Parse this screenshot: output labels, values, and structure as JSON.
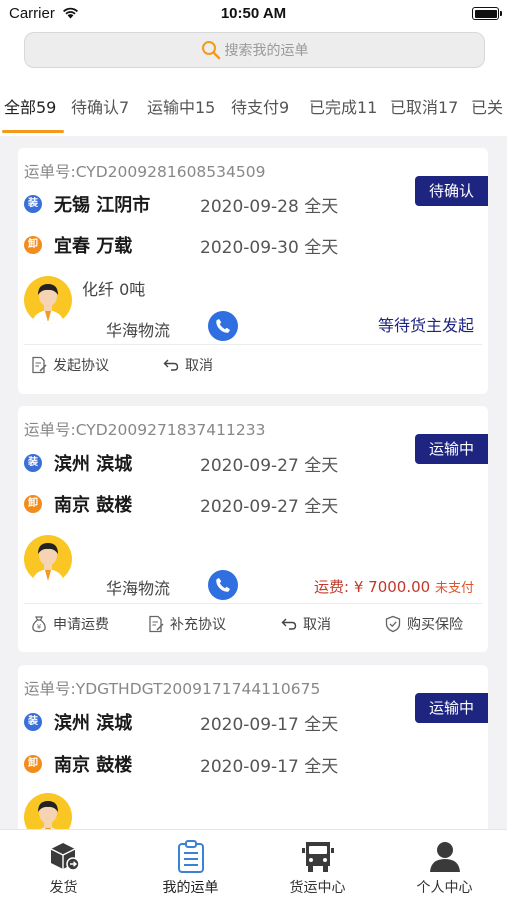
{
  "status_bar": {
    "carrier": "Carrier",
    "time": "10:50 AM"
  },
  "search": {
    "placeholder": "搜索我的运单"
  },
  "tabs": [
    {
      "label": "全部59",
      "active": true
    },
    {
      "label": "待确认7"
    },
    {
      "label": "运输中15"
    },
    {
      "label": "待支付9"
    },
    {
      "label": "已完成11"
    },
    {
      "label": "已取消17"
    },
    {
      "label": "已关"
    }
  ],
  "orders": [
    {
      "order_no": "运单号:CYD2009281608534509",
      "status": "待确认",
      "load_badge": "装",
      "unload_badge": "卸",
      "from": "无锡 江阴市",
      "from_date": "2020-09-28 全天",
      "to": "宜春 万载",
      "to_date": "2020-09-30 全天",
      "cargo": "化纤   0吨",
      "company": "华海物流",
      "note": "等待货主发起",
      "actions": [
        "发起协议",
        "取消"
      ]
    },
    {
      "order_no": "运单号:CYD2009271837411233",
      "status": "运输中",
      "load_badge": "装",
      "unload_badge": "卸",
      "from": "滨州 滨城",
      "from_date": "2020-09-27 全天",
      "to": "南京 鼓楼",
      "to_date": "2020-09-27 全天",
      "company": "华海物流",
      "fee": "运费: ¥ 7000.00",
      "fee_status": "未支付",
      "actions": [
        "申请运费",
        "补充协议",
        "取消",
        "购买保险"
      ]
    },
    {
      "order_no": "运单号:YDGTHDGT2009171744110675",
      "status": "运输中",
      "load_badge": "装",
      "unload_badge": "卸",
      "from": "滨州 滨城",
      "from_date": "2020-09-17 全天",
      "to": "南京 鼓楼",
      "to_date": "2020-09-17 全天"
    }
  ],
  "bottom_nav": [
    {
      "label": "发货",
      "icon": "box-icon"
    },
    {
      "label": "我的运单",
      "icon": "clipboard-icon",
      "active": true
    },
    {
      "label": "货运中心",
      "icon": "truck-icon"
    },
    {
      "label": "个人中心",
      "icon": "person-icon"
    }
  ],
  "colors": {
    "accent": "#f39a1d",
    "badge": "#1e2580",
    "phone": "#2f6fe0",
    "load": "#3a6fd8",
    "unload": "#f28c1c",
    "fee": "#c0392b"
  }
}
